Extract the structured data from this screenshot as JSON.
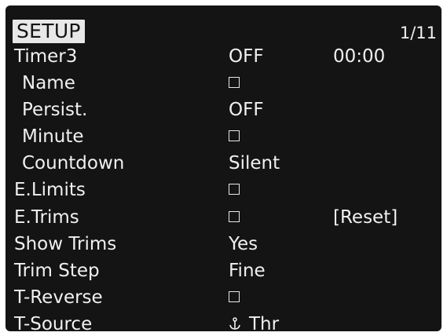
{
  "header": {
    "title": "SETUP",
    "page": "1/11"
  },
  "rows": {
    "timer3": {
      "label": "Timer3",
      "value": "OFF",
      "value2": "00:00"
    },
    "name": {
      "label": "Name",
      "checked": false
    },
    "persist": {
      "label": "Persist.",
      "value": "OFF"
    },
    "minute": {
      "label": "Minute",
      "checked": false
    },
    "countdown": {
      "label": "Countdown",
      "value": "Silent"
    },
    "elimits": {
      "label": "E.Limits",
      "checked": false
    },
    "etrims": {
      "label": "E.Trims",
      "checked": false,
      "action": "[Reset]"
    },
    "showtrims": {
      "label": "Show Trims",
      "value": "Yes"
    },
    "trimstep": {
      "label": "Trim Step",
      "value": "Fine"
    },
    "treverse": {
      "label": "T-Reverse",
      "checked": false
    },
    "tsource": {
      "label": "T-Source",
      "value": "Thr",
      "icon": "throttle-stick-icon"
    }
  },
  "colors": {
    "background": "#141414",
    "text": "#f0f0f0",
    "title_bg": "#e8e8e8"
  }
}
